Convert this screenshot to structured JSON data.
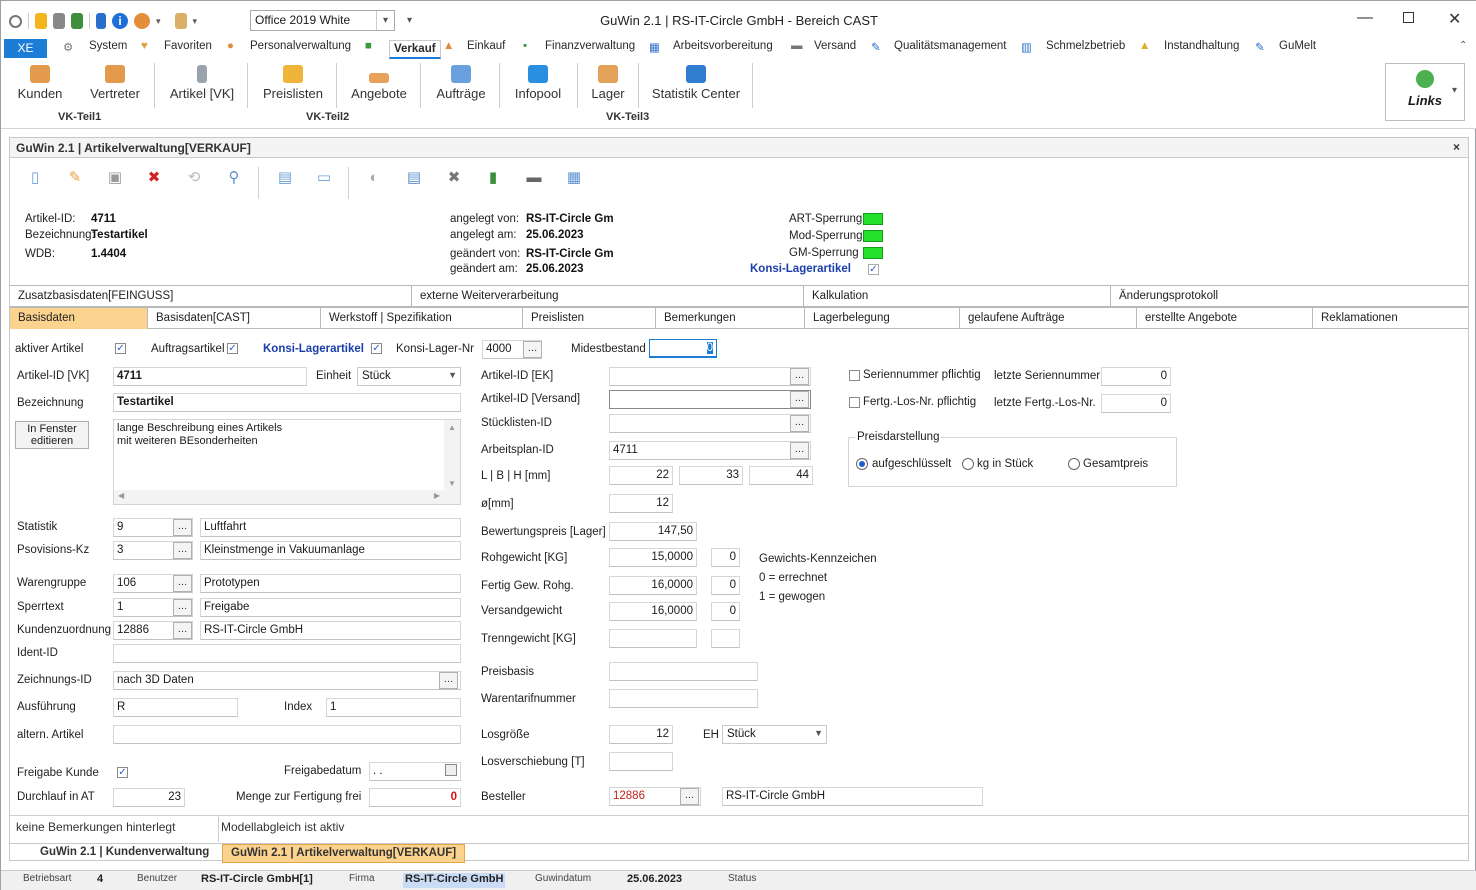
{
  "app": {
    "window_title": "GuWin 2.1 | RS-IT-Circle GmbH  - Bereich CAST",
    "theme": "Office 2019 White"
  },
  "menu": {
    "xe": "XE",
    "items": [
      "System",
      "Favoriten",
      "Personalverwaltung",
      "Verkauf",
      "Einkauf",
      "Finanzverwaltung",
      "Arbeitsvorbereitung",
      "Versand",
      "Qualitätsmanagement",
      "Schmelzbetrieb",
      "Instandhaltung",
      "GuMelt"
    ]
  },
  "ribbon": {
    "buttons": [
      "Kunden",
      "Vertreter",
      "Artikel [VK]",
      "Preislisten",
      "Angebote",
      "Aufträge",
      "Infopool",
      "Lager",
      "Statistik Center"
    ],
    "groups": [
      "VK-Teil1",
      "VK-Teil2",
      "VK-Teil3"
    ],
    "links": "Links"
  },
  "doc": {
    "title": "GuWin 2.1 | Artikelverwaltung[VERKAUF]",
    "close": "×"
  },
  "info": {
    "artikel_id_lbl": "Artikel-ID:",
    "artikel_id": "4711",
    "bezeichnung_lbl": "Bezeichnung:",
    "bezeichnung": "Testartikel",
    "wdb_lbl": "WDB:",
    "wdb": "1.4404",
    "angelegt_von_lbl": "angelegt von:",
    "angelegt_von": "RS-IT-Circle Gm",
    "angelegt_am_lbl": "angelegt am:",
    "angelegt_am": "25.06.2023",
    "geaendert_von_lbl": "geändert von:",
    "geaendert_von": "RS-IT-Circle Gm",
    "geaendert_am_lbl": "geändert am:",
    "geaendert_am": "25.06.2023",
    "art_sperrung": "ART-Sperrung",
    "mod_sperrung": "Mod-Sperrung",
    "gm_sperrung": "GM-Sperrung",
    "konsi": "Konsi-Lagerartikel"
  },
  "tabs_row1": [
    "Zusatzbasisdaten[FEINGUSS]",
    "externe Weiterverarbeitung",
    "Kalkulation",
    "Änderungsprotokoll"
  ],
  "tabs_row2": [
    "Basisdaten",
    "Basisdaten[CAST]",
    "Werkstoff | Spezifikation",
    "Preislisten",
    "Bemerkungen",
    "Lagerbelegung",
    "gelaufene Aufträge",
    "erstellte Angebote",
    "Reklamationen"
  ],
  "form": {
    "aktiver_artikel": "aktiver Artikel",
    "auftragsartikel": "Auftragsartikel",
    "konsi_lagerartikel": "Konsi-Lagerartikel",
    "konsi_lager_nr_lbl": "Konsi-Lager-Nr",
    "konsi_lager_nr": "4000",
    "mindestbestand_lbl": "Midestbestand",
    "mindestbestand": "0",
    "artikel_id_vk_lbl": "Artikel-ID [VK]",
    "artikel_id_vk": "4711",
    "einheit_lbl": "Einheit",
    "einheit": "Stück",
    "bezeichnung_lbl": "Bezeichnung",
    "bezeichnung": "Testartikel",
    "fenster_btn": "In Fenster editieren",
    "beschreibung_l1": "lange Beschreibung eines Artikels",
    "beschreibung_l2": "mit weiteren BEsonderheiten",
    "statistik_lbl": "Statistik",
    "statistik": "9",
    "statistik_txt": "Luftfahrt",
    "psovisions_lbl": "Psovisions-Kz",
    "psovisions": "3",
    "psovisions_txt": "Kleinstmenge in Vakuumanlage",
    "warengruppe_lbl": "Warengruppe",
    "warengruppe": "106",
    "warengruppe_txt": "Prototypen",
    "sperrtext_lbl": "Sperrtext",
    "sperrtext": "1",
    "sperrtext_txt": "Freigabe",
    "kundenzuordnung_lbl": "Kundenzuordnung",
    "kundenzuordnung": "12886",
    "kundenzuordnung_txt": "RS-IT-Circle GmbH",
    "ident_lbl": "Ident-ID",
    "zeichnung_lbl": "Zeichnungs-ID",
    "zeichnung": "nach 3D Daten",
    "ausfuehrung_lbl": "Ausführung",
    "ausfuehrung": "R",
    "index_lbl": "Index",
    "index": "1",
    "altern_lbl": "altern. Artikel",
    "freigabe_kunde_lbl": "Freigabe Kunde",
    "freigabedatum_lbl": "Freigabedatum",
    "freigabedatum": ". .",
    "durchlauf_lbl": "Durchlauf in AT",
    "durchlauf": "23",
    "menge_frei_lbl": "Menge zur Fertigung frei",
    "menge_frei": "0",
    "artikel_id_ek_lbl": "Artikel-ID [EK]",
    "artikel_id_versand_lbl": "Artikel-ID [Versand]",
    "stueckliste_lbl": "Stücklisten-ID",
    "arbeitsplan_lbl": "Arbeitsplan-ID",
    "arbeitsplan": "4711",
    "lbh_lbl": "L | B | H [mm]",
    "l": "22",
    "b": "33",
    "h": "44",
    "durchm_lbl": "ø[mm]",
    "durchm": "12",
    "bewertung_lbl": "Bewertungspreis [Lager]",
    "bewertung": "147,50",
    "rohgewicht_lbl": "Rohgewicht [KG]",
    "rohgewicht": "15,0000",
    "rohgewicht_k": "0",
    "fertig_lbl": "Fertig Gew. Rohg.",
    "fertig": "16,0000",
    "fertig_k": "0",
    "versand_lbl": "Versandgewicht",
    "versand": "16,0000",
    "versand_k": "0",
    "trenn_lbl": "Trenngewicht [KG]",
    "gk_title": "Gewichts-Kennzeichen",
    "gk_0": "0 = errechnet",
    "gk_1": "1 = gewogen",
    "preisbasis_lbl": "Preisbasis",
    "warentarif_lbl": "Warentarifnummer",
    "losgroesse_lbl": "Losgröße",
    "losgroesse": "12",
    "eh_lbl": "EH",
    "eh": "Stück",
    "losversch_lbl": "Losverschiebung [T]",
    "besteller_lbl": "Besteller",
    "besteller": "12886",
    "besteller_txt": "RS-IT-Circle GmbH",
    "sn_pflichtig": "Seriennummer pflichtig",
    "letzte_sn_lbl": "letzte Seriennummer",
    "letzte_sn": "0",
    "los_pflichtig": "Fertg.-Los-Nr. pflichtig",
    "letzte_los_lbl": "letzte Fertg.-Los-Nr.",
    "letzte_los": "0",
    "preisdarst": "Preisdarstellung",
    "r1": "aufgeschlüsselt",
    "r2": "kg in Stück",
    "r3": "Gesamtpreis"
  },
  "bottom": {
    "bemerkung": "keine Bemerkungen hinterlegt",
    "modell": "Modellabgleich ist aktiv"
  },
  "doctabs": [
    "GuWin 2.1 | Kundenverwaltung",
    "GuWin 2.1 | Artikelverwaltung[VERKAUF]"
  ],
  "status": {
    "betriebsart_lbl": "Betriebsart",
    "betriebsart": "4",
    "benutzer_lbl": "Benutzer",
    "benutzer": "RS-IT-Circle GmbH[1]",
    "firma_lbl": "Firma",
    "firma": "RS-IT-Circle GmbH",
    "datum_lbl": "Guwindatum",
    "datum": "25.06.2023",
    "status_lbl": "Status"
  },
  "colors": {
    "accent": "#1c7dd6",
    "active_tab": "#fbd38e",
    "green": "#22e12a",
    "red": "#d11"
  }
}
